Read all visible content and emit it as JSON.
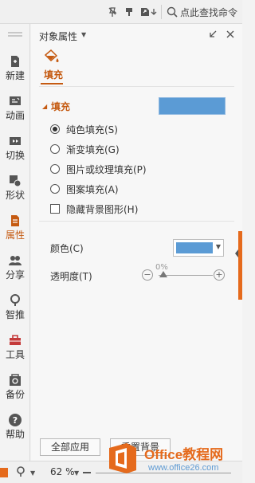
{
  "toolbar": {
    "search_text": "点此查找命令",
    "icons": [
      "pin-off-icon",
      "brush-icon",
      "share-icon",
      "arrow-down-icon",
      "search-icon"
    ]
  },
  "sidebar": {
    "items": [
      {
        "label": "新建",
        "icon": "new-slide-icon"
      },
      {
        "label": "动画",
        "icon": "animation-icon"
      },
      {
        "label": "切换",
        "icon": "transition-icon"
      },
      {
        "label": "形状",
        "icon": "shape-icon"
      },
      {
        "label": "属性",
        "icon": "properties-icon",
        "active": true
      },
      {
        "label": "分享",
        "icon": "share-people-icon"
      },
      {
        "label": "智推",
        "icon": "smart-push-icon"
      },
      {
        "label": "工具",
        "icon": "toolbox-icon"
      },
      {
        "label": "备份",
        "icon": "backup-icon"
      },
      {
        "label": "帮助",
        "icon": "help-icon"
      }
    ]
  },
  "panel": {
    "title": "对象属性",
    "fill_tab_label": "填充",
    "section_label": "填充",
    "fill_options": [
      {
        "label": "纯色填充(S)",
        "checked": true
      },
      {
        "label": "渐变填充(G)",
        "checked": false
      },
      {
        "label": "图片或纹理填充(P)",
        "checked": false
      },
      {
        "label": "图案填充(A)",
        "checked": false
      }
    ],
    "hide_background_label": "隐藏背景图形(H)",
    "hide_background_checked": false,
    "color_label": "颜色(C)",
    "transparency_label": "透明度(T)",
    "transparency_value": "0%",
    "apply_all_label": "全部应用",
    "reset_background_label": "重置背景"
  },
  "status": {
    "zoom": "62 %"
  },
  "watermark": {
    "title": "Office教程网",
    "url": "www.office26.com"
  },
  "colors": {
    "accent": "#c55a11",
    "fill": "#5b9bd5",
    "orange": "#e56a1c"
  }
}
